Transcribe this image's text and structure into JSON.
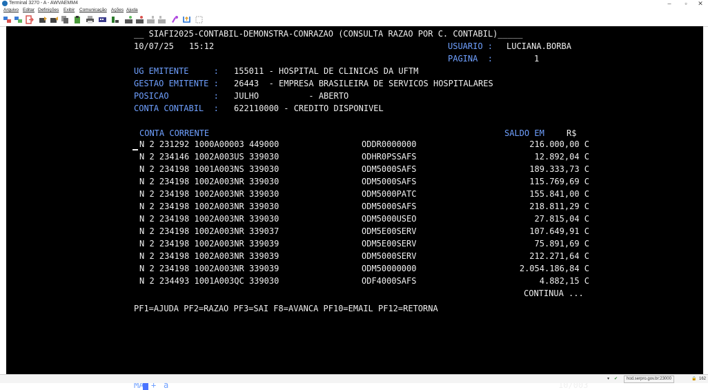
{
  "window": {
    "title": "Terminal 3270 - A - AWVAEMM4",
    "minimize": "–",
    "maximize": "▫",
    "close": "✕"
  },
  "menu": [
    "Arquivo",
    "Editar",
    "Definições",
    "Exibir",
    "Comunicação",
    "Ações",
    "Ajuda"
  ],
  "toolbar_icons": [
    "connect-icon",
    "disconnect-icon",
    "exit-icon",
    "send-file-icon",
    "receive-file-icon",
    "copy-icon",
    "paste-icon",
    "print-icon",
    "keyboard-icon",
    "macro-icon",
    "record-icon",
    "play-icon",
    "stop-icon",
    "pause-icon",
    "keypad-icon",
    "clear-icon",
    "restore-icon"
  ],
  "screen": {
    "header_line": "__ SIAFI2025-CONTABIL-DEMONSTRA-CONRAZAO (CONSULTA RAZAO POR C. CONTABIL)_____",
    "date": "10/07/25",
    "time": "15:12",
    "usuario_label": "USUARIO :",
    "usuario_value": "LUCIANA.BORBA",
    "pagina_label": "PAGINA  :",
    "pagina_value": "1",
    "ug_label": "UG EMITENTE     :",
    "ug_value": "155011 - HOSPITAL DE CLINICAS DA UFTM",
    "gestao_label": "GESTAO EMITENTE :",
    "gestao_value": "26443  - EMPRESA BRASILEIRA DE SERVICOS HOSPITALARES",
    "posicao_label": "POSICAO         :",
    "posicao_value": "JULHO          - ABERTO",
    "conta_label": "CONTA CONTABIL  :",
    "conta_value": "622110000 - CREDITO DISPONIVEL",
    "col_conta_corrente": "CONTA CORRENTE",
    "col_saldo": "SALDO EM",
    "col_currency": "R$",
    "rows": [
      {
        "conta": "N 2 231292 1000A00003 449000",
        "codigo": "ODDR0000000",
        "saldo": "216.000,00 C"
      },
      {
        "conta": "N 2 234146 1002A003US 339030",
        "codigo": "ODHR0PSSAFS",
        "saldo": "12.892,04 C"
      },
      {
        "conta": "N 2 234198 1001A003NS 339030",
        "codigo": "ODM5000SAFS",
        "saldo": "189.333,73 C"
      },
      {
        "conta": "N 2 234198 1002A003NR 339030",
        "codigo": "ODM5000SAFS",
        "saldo": "115.769,69 C"
      },
      {
        "conta": "N 2 234198 1002A003NR 339030",
        "codigo": "ODM5000PATC",
        "saldo": "155.841,00 C"
      },
      {
        "conta": "N 2 234198 1002A003NR 339030",
        "codigo": "ODM5000SAFS",
        "saldo": "218.811,29 C"
      },
      {
        "conta": "N 2 234198 1002A003NR 339030",
        "codigo": "ODM5000USEO",
        "saldo": "27.815,04 C"
      },
      {
        "conta": "N 2 234198 1002A003NR 339037",
        "codigo": "ODM5E00SERV",
        "saldo": "107.649,91 C"
      },
      {
        "conta": "N 2 234198 1002A003NR 339039",
        "codigo": "ODM5E00SERV",
        "saldo": "75.891,69 C"
      },
      {
        "conta": "N 2 234198 1002A003NR 339039",
        "codigo": "ODM5000SERV",
        "saldo": "212.271,64 C"
      },
      {
        "conta": "N 2 234198 1002A003NR 339039",
        "codigo": "ODM50000000",
        "saldo": "2.054.186,84 C"
      },
      {
        "conta": "N 2 234493 1001A003QC 339030",
        "codigo": "ODF4000SAFS",
        "saldo": "4.882,15 C"
      }
    ],
    "continua": "CONTINUA ...",
    "pf_keys": "PF1=AJUDA PF2=RAZAO PF3=SAI F8=AVANCA PF10=EMAIL PF12=RETORNA"
  },
  "oia": {
    "mode": "MA",
    "plus": "+",
    "indicator": "a",
    "cursor_pos": "10/003"
  },
  "statusbar": {
    "host": "hod.serpro.gov.br:23000",
    "lock": "🔒",
    "extra": "162"
  }
}
